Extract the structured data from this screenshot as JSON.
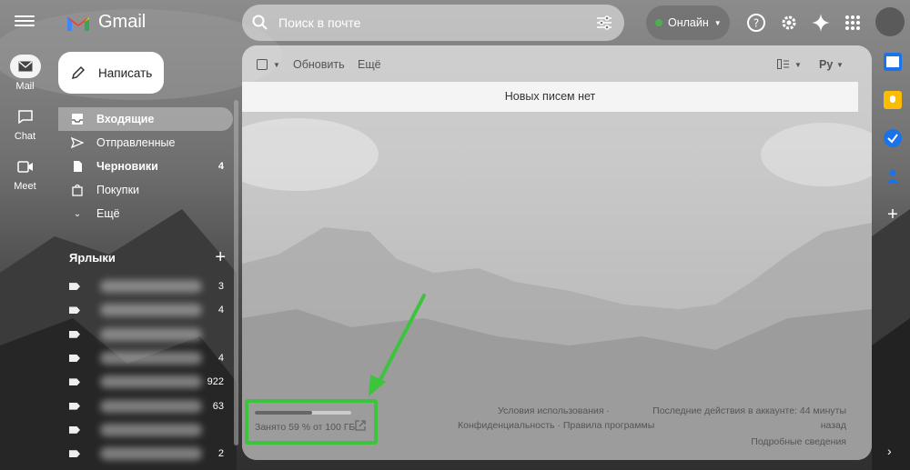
{
  "topbar": {
    "app_name": "Gmail",
    "search_placeholder": "Поиск в почте",
    "status_label": "Онлайн"
  },
  "rail": [
    {
      "label": "Mail"
    },
    {
      "label": "Chat"
    },
    {
      "label": "Meet"
    }
  ],
  "compose_label": "Написать",
  "nav": {
    "inbox": "Входящие",
    "sent": "Отправленные",
    "drafts": "Черновики",
    "drafts_count": "4",
    "purchases": "Покупки",
    "more": "Ещё"
  },
  "labels": {
    "title": "Ярлыки",
    "counts": [
      "3",
      "4",
      "",
      "4",
      "922",
      "63",
      "",
      "2"
    ]
  },
  "toolbar": {
    "refresh": "Обновить",
    "more": "Ещё",
    "lang": "Ру"
  },
  "empty_message": "Новых писем нет",
  "footer": {
    "storage_fraction": 0.59,
    "storage_text": "Занято 59 % от 100 ГБ",
    "terms": "Условия использования ·",
    "privacy": "Конфиденциальность · Правила программы",
    "activity_line1": "Последние действия в аккаунте: 44 минуты",
    "activity_line2": "назад",
    "details": "Подробные сведения"
  },
  "colors": {
    "highlight": "#3dc43d",
    "online_dot": "#4caf50"
  }
}
